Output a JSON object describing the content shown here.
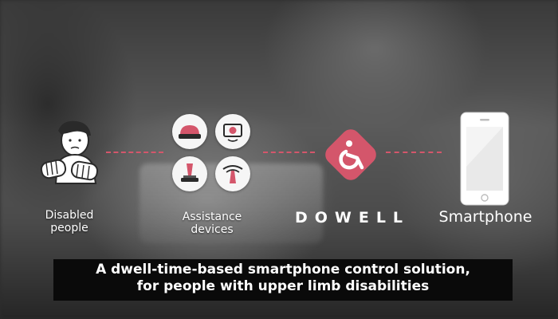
{
  "flow": {
    "items": [
      {
        "label_line1": "Disabled",
        "label_line2": "people"
      },
      {
        "label_line1": "Assistance",
        "label_line2": "devices"
      },
      {
        "label": "DOWELL"
      },
      {
        "label": "Smartphone"
      }
    ]
  },
  "caption": {
    "line1": "A dwell-time-based smartphone control solution,",
    "line2": "for people with upper limb disabilities"
  },
  "colors": {
    "accent": "#d4566b",
    "caption_bg": "#0a0a0a",
    "text": "#ffffff"
  },
  "icons": [
    "person-cast-arms-icon",
    "cushion-switch-icon",
    "camera-sensor-icon",
    "joystick-switch-icon",
    "sip-puff-icon",
    "dowell-logo-icon",
    "smartphone-icon"
  ]
}
